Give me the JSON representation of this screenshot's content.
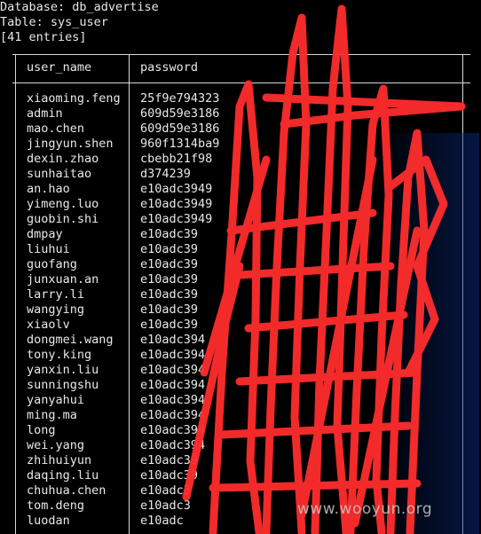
{
  "terminal": {
    "database_line": "Database: db_advertise",
    "table_line": "Table: sys_user",
    "entries_line": "[41 entries]"
  },
  "table": {
    "headers": [
      "user_name",
      "password"
    ],
    "rows": [
      {
        "user_name": "xiaoming.feng",
        "password": "25f9e794323"
      },
      {
        "user_name": "admin",
        "password": "609d59e3186"
      },
      {
        "user_name": "mao.chen",
        "password": "609d59e3186"
      },
      {
        "user_name": "jingyun.shen",
        "password": "960f1314ba9"
      },
      {
        "user_name": "dexin.zhao",
        "password": "cbebb21f98"
      },
      {
        "user_name": "sunhaitao",
        "password": "d374239"
      },
      {
        "user_name": "an.hao",
        "password": "e10adc3949"
      },
      {
        "user_name": "yimeng.luo",
        "password": "e10adc3949"
      },
      {
        "user_name": "guobin.shi",
        "password": "e10adc3949"
      },
      {
        "user_name": "dmpay",
        "password": "e10adc39"
      },
      {
        "user_name": "liuhui",
        "password": "e10adc39"
      },
      {
        "user_name": "guofang",
        "password": "e10adc39"
      },
      {
        "user_name": "junxuan.an",
        "password": "e10adc39"
      },
      {
        "user_name": "larry.li",
        "password": "e10adc39"
      },
      {
        "user_name": "wangying",
        "password": "e10adc39"
      },
      {
        "user_name": "xiaolv",
        "password": "e10adc39"
      },
      {
        "user_name": "dongmei.wang",
        "password": "e10adc394"
      },
      {
        "user_name": "tony.king",
        "password": "e10adc394"
      },
      {
        "user_name": "yanxin.liu",
        "password": "e10adc394"
      },
      {
        "user_name": "sunningshu",
        "password": "e10adc394"
      },
      {
        "user_name": "yanyahui",
        "password": "e10adc394"
      },
      {
        "user_name": "ming.ma",
        "password": "e10adc394"
      },
      {
        "user_name": "long",
        "password": "e10adc394"
      },
      {
        "user_name": "wei.yang",
        "password": "e10adc394"
      },
      {
        "user_name": "zhihuiyun",
        "password": "e10adc39"
      },
      {
        "user_name": "daqing.liu",
        "password": "e10adc39"
      },
      {
        "user_name": "chuhua.chen",
        "password": "e10adc3"
      },
      {
        "user_name": "tom.deng",
        "password": "e10adc3"
      },
      {
        "user_name": "luodan",
        "password": "e10adc"
      }
    ]
  },
  "watermark": "www.wooyun.org",
  "colors": {
    "background": "#000000",
    "text": "#e8e8e8",
    "scribble": "#ff3030"
  }
}
